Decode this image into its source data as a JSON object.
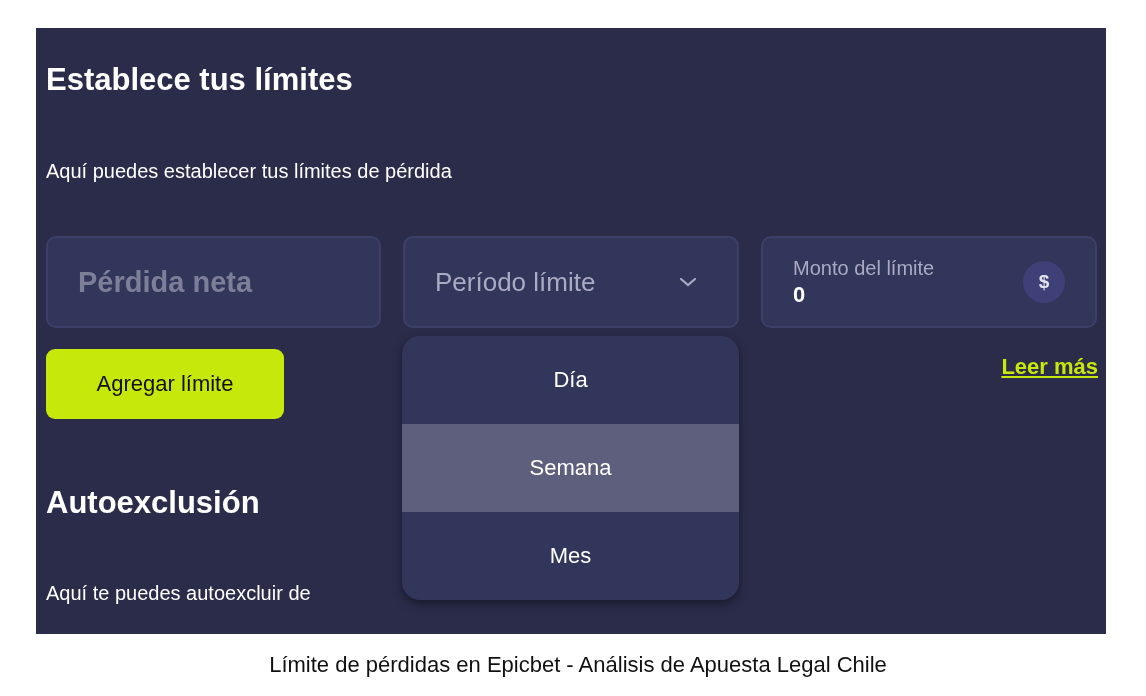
{
  "panel": {
    "title": "Establece tus límites",
    "subtitle": "Aquí puedes establecer tus límites de pérdida",
    "net_loss_field": {
      "placeholder": "Pérdida neta"
    },
    "period_dropdown": {
      "placeholder": "Período límite",
      "expanded": true,
      "options": [
        {
          "label": "Día",
          "selected": false
        },
        {
          "label": "Semana",
          "selected": true
        },
        {
          "label": "Mes",
          "selected": false
        }
      ]
    },
    "amount_field": {
      "label": "Monto del límite",
      "value": "0",
      "currency_symbol": "$"
    },
    "add_button": "Agregar límite",
    "read_more_link": "Leer más",
    "self_exclusion": {
      "title": "Autoexclusión",
      "description": "Aquí te puedes autoexcluir de"
    }
  },
  "caption": "Límite de pérdidas en Epicbet - Análisis de Apuesta Legal Chile"
}
